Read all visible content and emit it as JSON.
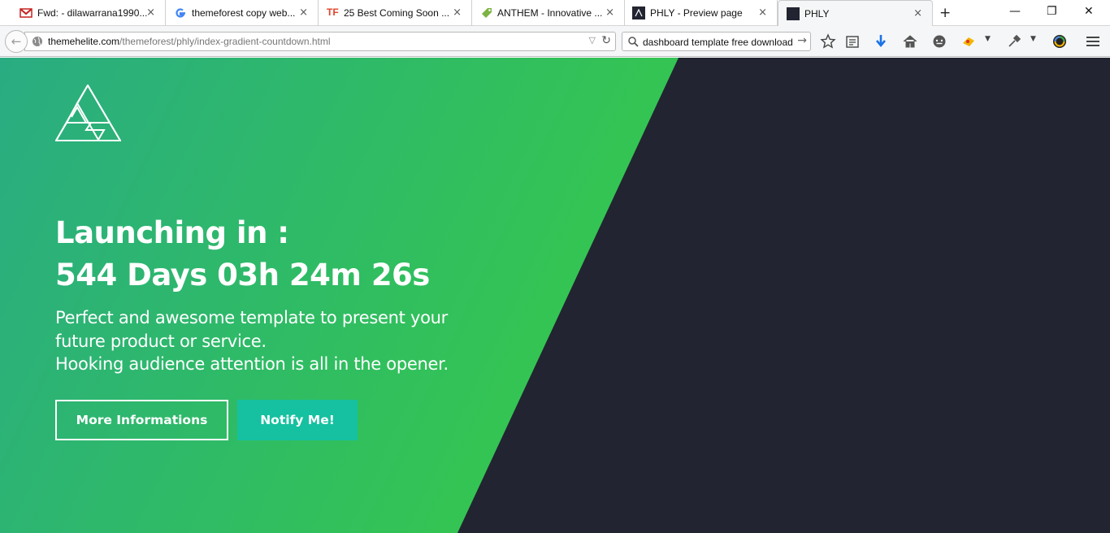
{
  "browser": {
    "tabs": [
      {
        "title": "Fwd: - dilawarrana1990...",
        "icon": "gmail-icon"
      },
      {
        "title": "themeforest copy web...",
        "icon": "google-icon"
      },
      {
        "title": "25 Best Coming Soon ...",
        "icon": "tf-icon",
        "icon_text": "TF"
      },
      {
        "title": "ANTHEM - Innovative ...",
        "icon": "tag-icon"
      },
      {
        "title": "PHLY - Preview page",
        "icon": "phly-icon"
      },
      {
        "title": "PHLY",
        "icon": "phly-icon",
        "active": true
      }
    ],
    "close_glyph": "×",
    "new_tab_glyph": "+",
    "window": {
      "minimize": "—",
      "restore": "❐",
      "close": "✕"
    },
    "url_host": "themehelite.com",
    "url_path": "/themeforest/phly/index-gradient-countdown.html",
    "search_text": "dashboard template free download",
    "toolbar_icons": [
      "bookmark-star-icon",
      "reading-list-icon",
      "download-icon",
      "home-icon",
      "chat-icon",
      "extension-icon",
      "menu-dropdown-icon",
      "eyedropper-icon",
      "menu-dropdown-icon",
      "color-wheel-icon",
      "hamburger-menu-icon"
    ]
  },
  "page": {
    "colors": {
      "green": "#35c64f",
      "teal": "#2aac82",
      "dark": "#222431",
      "notify_button": "#15c1a0"
    },
    "logo_icon": "impossible-triangle-icon",
    "launch_line1": "Launching in :",
    "countdown": "544 Days 03h 24m 26s",
    "tagline_line1": "Perfect and awesome template to present your",
    "tagline_line2": "future product or service.",
    "tagline_line3": "Hooking audience attention is all in the opener.",
    "button_more": "More Informations",
    "button_notify": "Notify Me!"
  }
}
